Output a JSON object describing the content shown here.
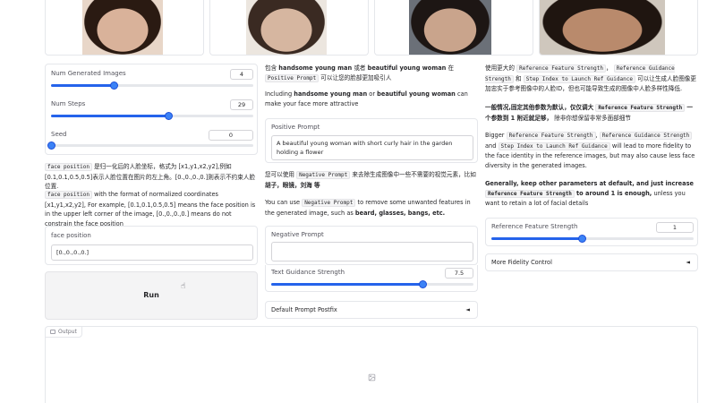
{
  "faces": [
    {
      "name": "face-1",
      "bg": "#e8d6c8",
      "skin": "#d9b29a",
      "hair": "#2a1a12"
    },
    {
      "name": "face-2",
      "bg": "#ece6df",
      "skin": "#d6b6a0",
      "hair": "#3a2a22"
    },
    {
      "name": "face-3",
      "bg": "#6b7078",
      "skin": "#c9a48c",
      "hair": "#1d1614"
    },
    {
      "name": "face-4",
      "bg": "#cfc7bd",
      "skin": "#b98a6c",
      "hair": "#1f1510"
    }
  ],
  "controls": {
    "num_images": {
      "label": "Num Generated Images",
      "value": "4",
      "fraction": 0.31
    },
    "num_steps": {
      "label": "Num Steps",
      "value": "29",
      "fraction": 0.58
    },
    "seed": {
      "label": "Seed",
      "value": "0",
      "fraction": 0.0
    }
  },
  "face_position_help": {
    "cn_code": "face position",
    "cn_text": "是归一化后的人脸坐标，格式为 [x1,y1,x2,y2],例如 [0.1,0.1,0.5,0.5]表示人脸位置在图片的左上角。[0.,0.,0.,0.]则表示不约束人脸位置.",
    "en_code": "face position",
    "en_text": "with the format of normalized coordinates [x1,y1,x2,y2], For example, [0.1,0.1,0.5,0.5] means the face position is in the upper left corner of the image, [0.,0.,0.,0.] means do not constrain the face position"
  },
  "face_position": {
    "label": "face position",
    "value": "[0.,0.,0.,0.]"
  },
  "run_label": "Run",
  "middle": {
    "cn_prompt_1": "包含",
    "cn_prompt_b1": "handsome young man",
    "cn_prompt_2": "或者",
    "cn_prompt_b2": "beautiful young woman",
    "cn_prompt_3": "在",
    "cn_prompt_code": "Positive Prompt",
    "cn_prompt_4": "可以让您的脸部更加吸引人",
    "en_prompt_1": "Including",
    "en_prompt_b1": "handsome young man",
    "en_prompt_2": "or",
    "en_prompt_b2": "beautiful young woman",
    "en_prompt_3": "can make your face more attractive",
    "positive_label": "Positive Prompt",
    "positive_value": "A beautiful young woman with short curly hair in the garden holding a flower",
    "cn_neg_1": "您可以使用",
    "cn_neg_code": "Negative Prompt",
    "cn_neg_2": "来去除生成图像中一些不需要的视觉元素，比如",
    "cn_neg_b": "胡子，眼镜，刘海 等",
    "en_neg_1": "You can use",
    "en_neg_code": "Negative Prompt",
    "en_neg_2": "to remove some unwanted features in the generated image, such as",
    "en_neg_b": "beard, glasses, bangs, etc.",
    "negative_label": "Negative Prompt",
    "negative_value": "",
    "guidance_label": "Text Guidance Strength",
    "guidance_value": "7.5",
    "guidance_fraction": 0.75,
    "postfix_label": "Default Prompt Postfix",
    "postfix_arrow": "◄"
  },
  "right": {
    "cn_1": "使用更大的",
    "cn_code1": "Reference Feature Strength",
    "cn_2": "，",
    "cn_code2": "Reference Guidance Strength",
    "cn_3": "和",
    "cn_code3": "Step Index to Launch Ref Guidance",
    "cn_4": "可以让生成人脸图像更加忠实于参考图像中的人脸ID，但也可能导致生成的图像中人脸多样性降低.",
    "cn_b1": "一般情况,固定其他参数为默认，仅仅调大",
    "cn_b_code": "Reference Feature Strength",
    "cn_b2": "一个参数到 1 附近就足够，",
    "cn_b3": "除非你想保留非常多面部细节",
    "en_1": "Bigger",
    "en_code1": "Reference Feature Strength",
    "en_2": ",",
    "en_code2": "Reference Guidance Strength",
    "en_3": "and",
    "en_code3": "Step Index to Launch Ref Guidance",
    "en_4": "will lead to more fidelity to the face identity in the reference images, but may also cause less face diversity in the generated images.",
    "en_b1": "Generally, keep other parameters at default, and just increase",
    "en_b_code": "Reference Feature Strength",
    "en_b2": "to around 1 is enough,",
    "en_b3": "unless you want to retain a lot of facial details",
    "ref_label": "Reference Feature Strength",
    "ref_value": "1",
    "ref_fraction": 0.45,
    "fidelity_label": "More Fidelity Control",
    "fidelity_arrow": "◄"
  },
  "output": {
    "label": "Output"
  }
}
